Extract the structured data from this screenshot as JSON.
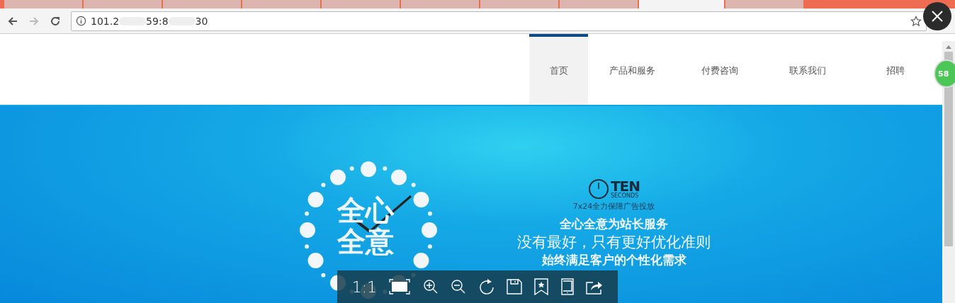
{
  "browser": {
    "tabs": [
      {
        "selected": false
      },
      {
        "selected": false
      },
      {
        "selected": false
      },
      {
        "selected": false
      },
      {
        "selected": false
      },
      {
        "selected": false
      },
      {
        "selected": false
      },
      {
        "selected": false
      },
      {
        "selected": true
      },
      {
        "selected": false
      }
    ],
    "address": {
      "parts": [
        "101.2",
        "59:8",
        "30"
      ]
    }
  },
  "nav": {
    "items": [
      {
        "label": "首页",
        "selected": true
      },
      {
        "label": "产品和服务",
        "selected": false
      },
      {
        "label": "付费咨询",
        "selected": false
      },
      {
        "label": "联系我们",
        "selected": false
      },
      {
        "label": "招聘",
        "selected": false
      }
    ]
  },
  "banner": {
    "clock_text": [
      "全心",
      "全意"
    ],
    "logo": {
      "name": "TEN",
      "sub": "SECONDS"
    },
    "tagline": "7x24全力保障广告投放",
    "lines": [
      "全心全意为站长服务",
      "没有最好，只有更好优化准则",
      "始终满足客户的个性化需求"
    ]
  },
  "badge": "58",
  "viewer": {
    "ratio_label": "1:1"
  }
}
